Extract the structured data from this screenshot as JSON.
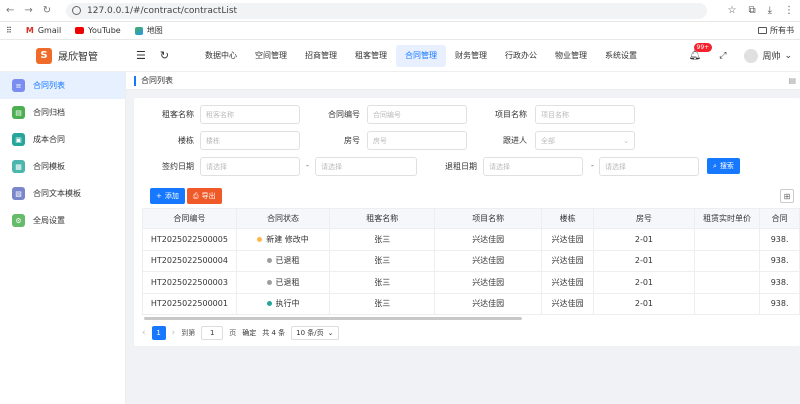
{
  "browser": {
    "url": "127.0.0.1/#/contract/contractList",
    "bookmarks": [
      {
        "label": "Gmail"
      },
      {
        "label": "YouTube"
      },
      {
        "label": "地图"
      }
    ],
    "bookmarks_right": "所有书"
  },
  "app": {
    "logo_text": "S",
    "title": "晟欣智管",
    "menus": [
      "数据中心",
      "空间管理",
      "招商管理",
      "租客管理",
      "合同管理",
      "财务管理",
      "行政办公",
      "物业管理",
      "系统设置"
    ],
    "active_menu": "合同管理",
    "notification_badge": "99+",
    "user_name": "周帅"
  },
  "sidebar": {
    "items": [
      {
        "label": "合同列表",
        "color": "#7b8df0"
      },
      {
        "label": "合同归档",
        "color": "#4caf50"
      },
      {
        "label": "成本合同",
        "color": "#26a69a"
      },
      {
        "label": "合同模板",
        "color": "#4db6ac"
      },
      {
        "label": "合同文本模板",
        "color": "#7986cb"
      },
      {
        "label": "全局设置",
        "color": "#66bb6a"
      }
    ],
    "active": "合同列表"
  },
  "breadcrumb": "合同列表",
  "filters": {
    "tenant_name_label": "租客名称",
    "tenant_name_placeholder": "租客名称",
    "contract_no_label": "合同编号",
    "contract_no_placeholder": "合同编号",
    "project_label": "项目名称",
    "project_placeholder": "项目名称",
    "building_label": "楼栋",
    "building_placeholder": "楼栋",
    "room_label": "房号",
    "room_placeholder": "房号",
    "follower_label": "跟进人",
    "follower_value": "全部",
    "sign_date_label": "签约日期",
    "select_placeholder": "请选择",
    "exit_date_label": "退租日期",
    "dash": "-",
    "search_button": "搜索"
  },
  "toolbar": {
    "add_button": "添加",
    "export_button": "导出"
  },
  "table": {
    "headers": [
      "合同编号",
      "合同状态",
      "租客名称",
      "项目名称",
      "楼栋",
      "房号",
      "租赁实时单价",
      "合同"
    ],
    "rows": [
      {
        "no": "HT2025022500005",
        "status": "新建 修改中",
        "status_color": "#ffb74d",
        "tenant": "张三",
        "project": "兴达佳园",
        "building": "兴达佳园",
        "room": "2-01",
        "price": "",
        "extra": "938."
      },
      {
        "no": "HT2025022500004",
        "status": "已退租",
        "status_color": "#9e9e9e",
        "tenant": "张三",
        "project": "兴达佳园",
        "building": "兴达佳园",
        "room": "2-01",
        "price": "",
        "extra": "938."
      },
      {
        "no": "HT2025022500003",
        "status": "已退租",
        "status_color": "#9e9e9e",
        "tenant": "张三",
        "project": "兴达佳园",
        "building": "兴达佳园",
        "room": "2-01",
        "price": "",
        "extra": "938."
      },
      {
        "no": "HT2025022500001",
        "status": "执行中",
        "status_color": "#26a69a",
        "tenant": "张三",
        "project": "兴达佳园",
        "building": "兴达佳园",
        "room": "2-01",
        "price": "",
        "extra": "938."
      }
    ]
  },
  "pagination": {
    "current": "1",
    "goto_label": "到第",
    "goto_value": "1",
    "page_unit": "页",
    "confirm": "确定",
    "total": "共 4 条",
    "page_size": "10 条/页"
  }
}
